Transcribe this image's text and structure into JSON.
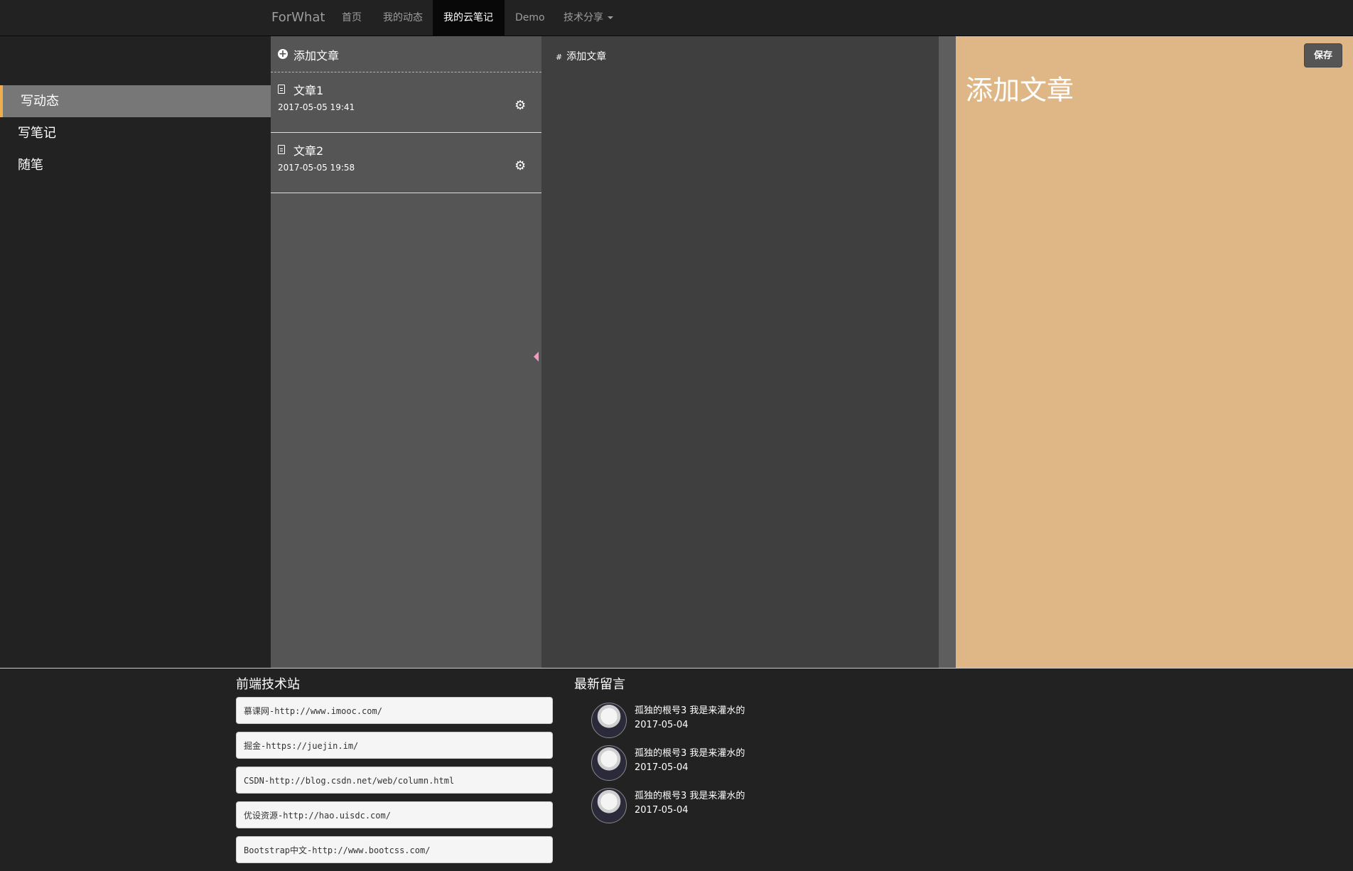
{
  "nav": {
    "brand": "ForWhat",
    "items": [
      {
        "label": "首页"
      },
      {
        "label": "我的动态"
      },
      {
        "label": "我的云笔记"
      },
      {
        "label": "Demo"
      },
      {
        "label": "技术分享"
      }
    ]
  },
  "sidebar": {
    "items": [
      {
        "label": "写动态"
      },
      {
        "label": "写笔记"
      },
      {
        "label": "随笔"
      }
    ]
  },
  "article_list": {
    "add_label": "添加文章",
    "articles": [
      {
        "title": "文章1",
        "date": "2017-05-05 19:41"
      },
      {
        "title": "文章2",
        "date": "2017-05-05 19:58"
      }
    ]
  },
  "editor": {
    "hash": "#",
    "content": "添加文章"
  },
  "preview": {
    "title": "添加文章",
    "save_label": "保存"
  },
  "footer": {
    "links_title": "前端技术站",
    "links": [
      "慕课网-http://www.imooc.com/",
      "掘金-https://juejin.im/",
      "CSDN-http://blog.csdn.net/web/column.html",
      "优设资源-http://hao.uisdc.com/",
      "Bootstrap中文-http://www.bootcss.com/"
    ],
    "comments_title": "最新留言",
    "comments": [
      {
        "text": "孤独的根号3 我是来灌水的",
        "date": "2017-05-04"
      },
      {
        "text": "孤独的根号3 我是来灌水的",
        "date": "2017-05-04"
      },
      {
        "text": "孤独的根号3 我是来灌水的",
        "date": "2017-05-04"
      }
    ]
  },
  "colors": {
    "accent": "#f0ad4e",
    "preview_bg": "#dfb787",
    "navbar_bg": "#222222"
  }
}
